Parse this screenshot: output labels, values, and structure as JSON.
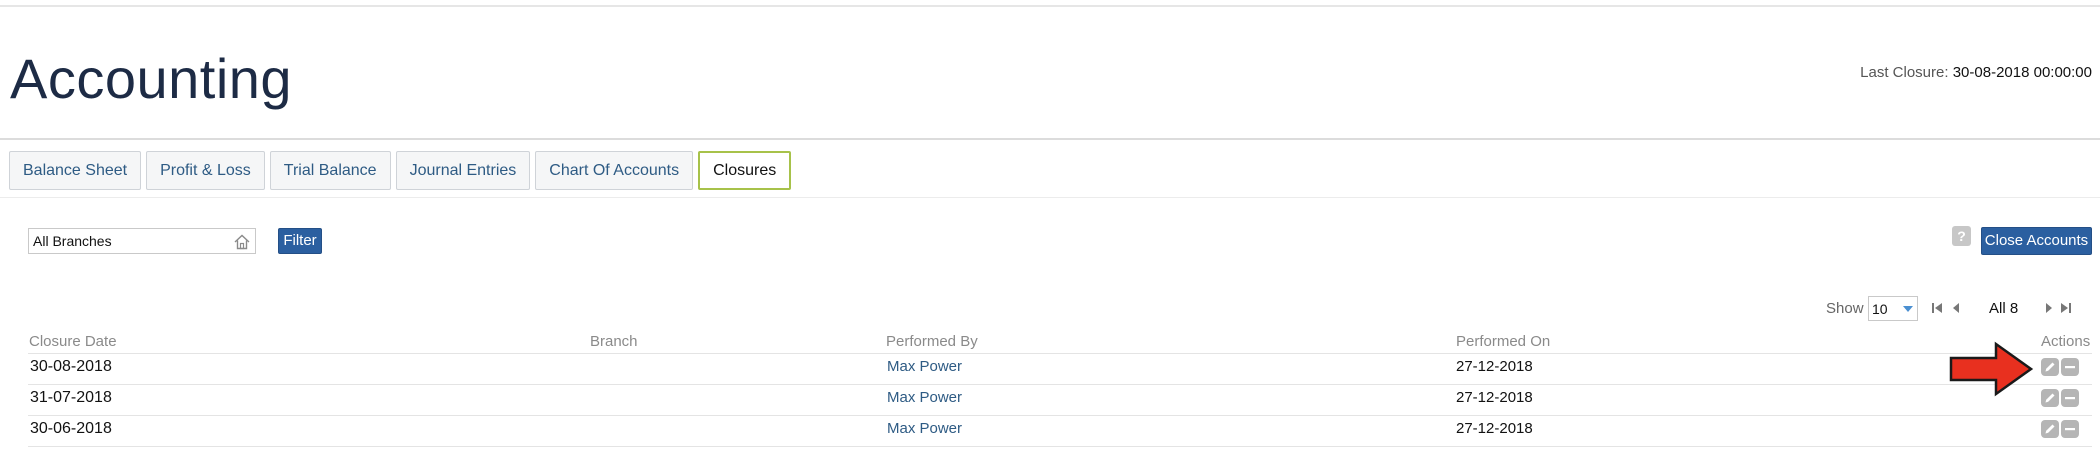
{
  "page": {
    "title": "Accounting",
    "last_closure_label": "Last Closure:",
    "last_closure_value": "30-08-2018 00:00:00"
  },
  "tabs": [
    {
      "label": "Balance Sheet",
      "active": false
    },
    {
      "label": "Profit & Loss",
      "active": false
    },
    {
      "label": "Trial Balance",
      "active": false
    },
    {
      "label": "Journal Entries",
      "active": false
    },
    {
      "label": "Chart Of Accounts",
      "active": false
    },
    {
      "label": "Closures",
      "active": true
    }
  ],
  "toolbar": {
    "branch_select_value": "All Branches",
    "filter_label": "Filter",
    "help_label": "?",
    "close_accounts_label": "Close Accounts"
  },
  "pagination": {
    "show_label": "Show",
    "page_size": "10",
    "page_info": "All 8"
  },
  "table": {
    "columns": [
      "Closure Date",
      "Branch",
      "Performed By",
      "Performed On",
      "Actions"
    ],
    "rows": [
      {
        "closure_date": "30-08-2018",
        "branch": "",
        "performed_by": "Max Power",
        "performed_on": "27-12-2018"
      },
      {
        "closure_date": "31-07-2018",
        "branch": "",
        "performed_by": "Max Power",
        "performed_on": "27-12-2018"
      },
      {
        "closure_date": "30-06-2018",
        "branch": "",
        "performed_by": "Max Power",
        "performed_on": "27-12-2018"
      }
    ]
  },
  "icons": {
    "home": "home-icon",
    "caret": "caret-down-icon",
    "first": "first-page-icon",
    "prev": "prev-page-icon",
    "next": "next-page-icon",
    "last": "last-page-icon",
    "edit": "edit-icon",
    "delete": "delete-icon",
    "annotation": "red-arrow-icon"
  },
  "colors": {
    "title": "#1d2b45",
    "link": "#2e5b84",
    "primary_button": "#2b5fa0",
    "active_tab_border": "#a7c24a",
    "annotation_arrow": "#e8301f"
  }
}
